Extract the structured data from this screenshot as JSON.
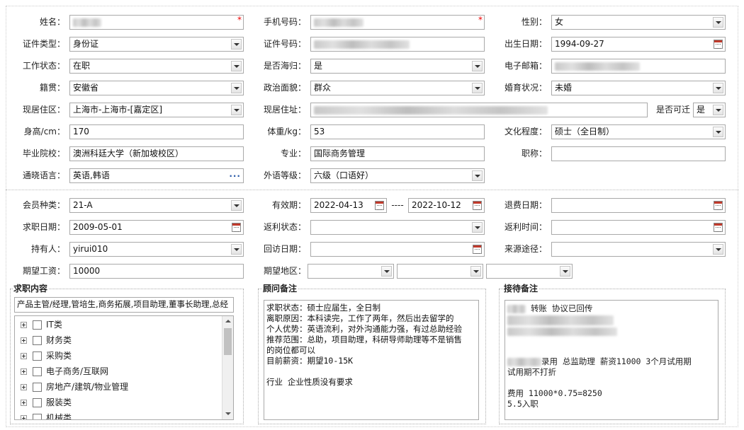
{
  "personal": {
    "name_label": "姓名：",
    "phone_label": "手机号码：",
    "gender_label": "性别：",
    "gender_value": "女",
    "id_type_label": "证件类型：",
    "id_type_value": "身份证",
    "id_number_label": "证件号码：",
    "birth_label": "出生日期：",
    "birth_value": "1994-09-27",
    "work_status_label": "工作状态：",
    "work_status_value": "在职",
    "returnee_label": "是否海归：",
    "returnee_value": "是",
    "email_label": "电子邮箱：",
    "origin_label": "籍贯：",
    "origin_value": "安徽省",
    "political_label": "政治面貌：",
    "political_value": "群众",
    "marital_label": "婚育状况：",
    "marital_value": "未婚",
    "residence_label": "现居住区：",
    "residence_value": "上海市-上海市-[嘉定区]",
    "address_label": "现居住址：",
    "relocate_label": "是否可迁",
    "relocate_value": "是",
    "height_label": "身高/cm：",
    "height_value": "170",
    "weight_label": "体重/kg：",
    "weight_value": "53",
    "education_label": "文化程度：",
    "education_value": "硕士（全日制）",
    "school_label": "毕业院校：",
    "school_value": "澳洲科廷大学（新加坡校区）",
    "major_label": "专业：",
    "major_value": "国际商务管理",
    "title_label": "职称：",
    "language_label": "通晓语言：",
    "language_value": "英语,韩语",
    "language_level_label": "外语等级：",
    "language_level_value": "六级（口语好）"
  },
  "membership": {
    "member_type_label": "会员种类：",
    "member_type_value": "21-A",
    "validity_label": "有效期：",
    "validity_from": "2022-04-13",
    "validity_sep": "----",
    "validity_to": "2022-10-12",
    "refund_date_label": "退费日期：",
    "job_date_label": "求职日期：",
    "job_date_value": "2009-05-01",
    "rebate_status_label": "返利状态：",
    "rebate_time_label": "返利时间：",
    "holder_label": "持有人：",
    "holder_value": "yirui010",
    "visit_date_label": "回访日期：",
    "source_label": "来源途径：",
    "salary_label": "期望工资：",
    "salary_value": "10000",
    "region_label": "期望地区："
  },
  "job_content": {
    "legend": "求职内容",
    "summary": "产品主管/经理,管培生,商务拓展,项目助理,董事长助理,总经",
    "categories": [
      "IT类",
      "财务类",
      "采购类",
      "电子商务/互联网",
      "房地产/建筑/物业管理",
      "服装类",
      "机械类"
    ]
  },
  "consultant_notes": {
    "legend": "顾问备注",
    "text": "求职状态：硕士应届生，全日制\n离职原因：本科读完，工作了两年，然后出去留学的\n个人优势：英语流利，对外沟通能力强，有过总助经验\n推荐范围：总助，项目助理，科研导师助理等不是销售\n的岗位都可以\n目前薪资：期望10-15K\n\n行业 企业性质没有要求"
  },
  "reception_notes": {
    "legend": "接待备注",
    "line1": "转账 协议已回传",
    "line2": "录用  总监助理 薪资11000 3个月试用期",
    "line3": "试用期不打折",
    "line4": "费用 11000*0.75=8250",
    "line5": "5.5入职"
  }
}
